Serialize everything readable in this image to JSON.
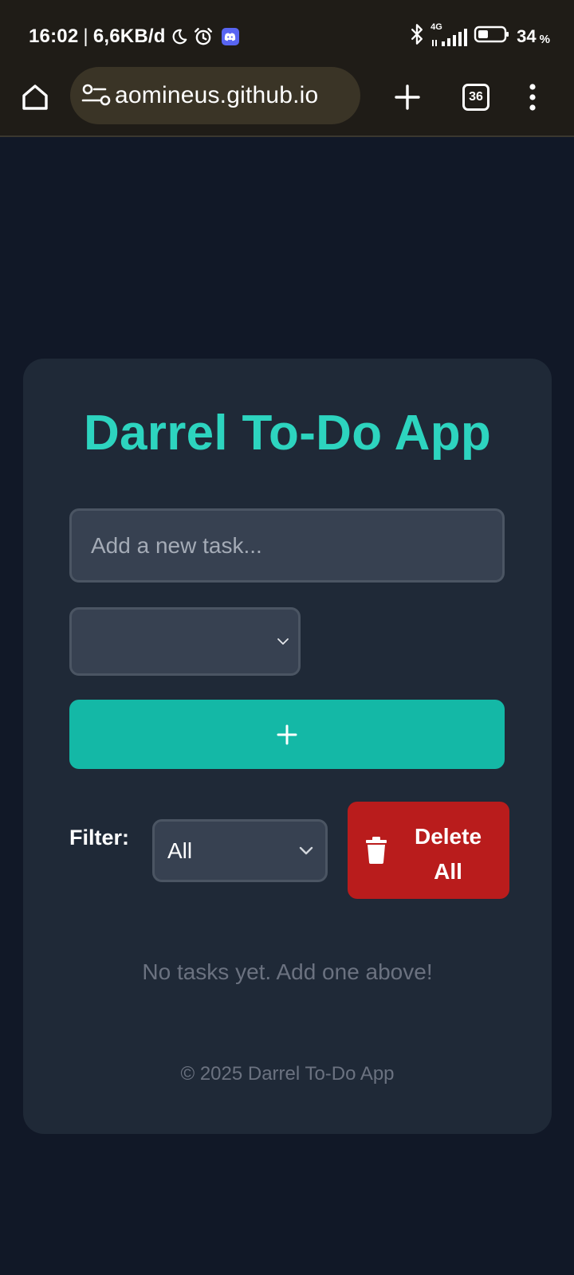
{
  "status_bar": {
    "time": "16:02",
    "separator": "|",
    "data_speed": "6,6KB/d",
    "network": "4G",
    "battery_level": "34",
    "battery_unit": "%",
    "icons": [
      "moon-icon",
      "alarm-icon",
      "discord-icon",
      "bluetooth-icon",
      "signal-icon",
      "battery-icon"
    ]
  },
  "browser": {
    "url": "aomineus.github.io",
    "tab_count": "36",
    "icons": [
      "home-icon",
      "site-settings-icon",
      "new-tab-icon",
      "menu-icon"
    ]
  },
  "app": {
    "title": "Darrel To-Do App",
    "task_placeholder": "Add a new task...",
    "task_value": "",
    "priority_selected": "",
    "add_button_icon": "plus-icon",
    "filter_label": "Filter:",
    "filter_selected": "All",
    "delete_all_line1": "Delete",
    "delete_all_line2": "All",
    "empty_message": "No tasks yet. Add one above!",
    "footer": "© 2025 Darrel To-Do App"
  },
  "colors": {
    "page_bg": "#111827",
    "card_bg": "#1f2937",
    "title_accent": "#2dd4bf",
    "add_button": "#14b8a6",
    "delete_button": "#b91c1c",
    "input_bg": "#374151",
    "chrome_bg": "#1f1c17"
  }
}
